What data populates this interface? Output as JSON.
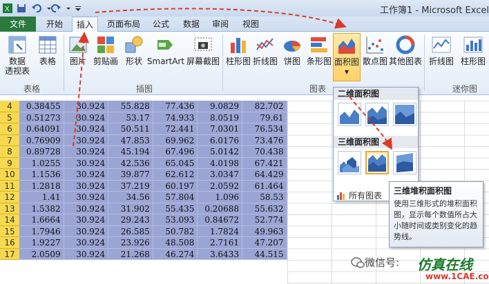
{
  "window": {
    "title": "工作簿1 - Microsoft Excel"
  },
  "tabs": [
    {
      "label": "文件"
    },
    {
      "label": "开始"
    },
    {
      "label": "插入"
    },
    {
      "label": "页面布局"
    },
    {
      "label": "公式"
    },
    {
      "label": "数据"
    },
    {
      "label": "审阅"
    },
    {
      "label": "视图"
    }
  ],
  "ribbon": {
    "pivot": {
      "label": "数据",
      "label2": "透视表"
    },
    "table": {
      "label": "表格"
    },
    "picture": {
      "label": "图片"
    },
    "clipart": {
      "label": "剪贴画"
    },
    "shapes": {
      "label": "形状"
    },
    "smartart": {
      "label": "SmartArt"
    },
    "screenshot": {
      "label": "屏幕截图"
    },
    "column": {
      "label": "柱形图"
    },
    "line": {
      "label": "折线图"
    },
    "pie": {
      "label": "饼图"
    },
    "bar": {
      "label": "条形图"
    },
    "area": {
      "label": "面积图"
    },
    "scatter": {
      "label": "散点图"
    },
    "other": {
      "label": "其他图表"
    },
    "spark_line": {
      "label": "折线图"
    },
    "spark_column": {
      "label": "柱形图"
    },
    "groups": {
      "tables": "表格",
      "illustrations": "插图",
      "charts": "图表",
      "sparklines": "迷你图"
    }
  },
  "gallery": {
    "header_2d": "二维面积图",
    "header_3d": "三维面积图",
    "all_charts": "所有图表"
  },
  "tooltip": {
    "title": "三维堆积面积图",
    "desc": "使用三维形式的堆积面积图，显示每个数值所占大小随时间或类别变化的趋势线。"
  },
  "rows": [
    {
      "n": "4",
      "c": [
        "0.38455",
        "30.924",
        "55.828",
        "77.436",
        "9.0829",
        "82.702"
      ]
    },
    {
      "n": "5",
      "c": [
        "0.51273",
        "30.924",
        "53.17",
        "74.933",
        "8.0519",
        "79.61"
      ]
    },
    {
      "n": "6",
      "c": [
        "0.64091",
        "30.924",
        "50.511",
        "72.441",
        "7.0301",
        "76.534"
      ]
    },
    {
      "n": "7",
      "c": [
        "0.76909",
        "30.924",
        "47.853",
        "69.962",
        "6.0176",
        "73.476"
      ]
    },
    {
      "n": "8",
      "c": [
        "0.89728",
        "30.924",
        "45.194",
        "67.496",
        "5.0142",
        "70.438"
      ]
    },
    {
      "n": "9",
      "c": [
        "1.0255",
        "30.924",
        "42.536",
        "65.045",
        "4.0198",
        "67.421"
      ]
    },
    {
      "n": "10",
      "c": [
        "1.1536",
        "30.924",
        "39.877",
        "62.612",
        "3.0347",
        "64.429"
      ]
    },
    {
      "n": "11",
      "c": [
        "1.2818",
        "30.924",
        "37.219",
        "60.197",
        "2.0592",
        "61.464"
      ]
    },
    {
      "n": "12",
      "c": [
        "1.41",
        "30.924",
        "34.56",
        "57.804",
        "1.096",
        "58.53"
      ]
    },
    {
      "n": "13",
      "c": [
        "1.5382",
        "30.924",
        "31.902",
        "55.435",
        "0.20688",
        "55.632"
      ]
    },
    {
      "n": "14",
      "c": [
        "1.6664",
        "30.924",
        "29.243",
        "53.093",
        "0.84672",
        "52.774"
      ]
    },
    {
      "n": "15",
      "c": [
        "1.7946",
        "30.924",
        "26.585",
        "50.782",
        "1.7824",
        "49.963"
      ]
    },
    {
      "n": "16",
      "c": [
        "1.9227",
        "30.924",
        "23.926",
        "48.508",
        "2.7161",
        "47.207"
      ]
    },
    {
      "n": "17",
      "c": [
        "2.0509",
        "30.924",
        "21.268",
        "46.274",
        "3.6433",
        "44.515"
      ]
    }
  ],
  "watermark": {
    "wechat": "微信号:",
    "brand": "仿真在线",
    "url": "www.1CAE.com"
  },
  "colors": {
    "file_tab": "#2a7a3e",
    "row_header": "#f7d94f",
    "selection": "#9aa5d4",
    "arrow": "#d93a2a"
  }
}
